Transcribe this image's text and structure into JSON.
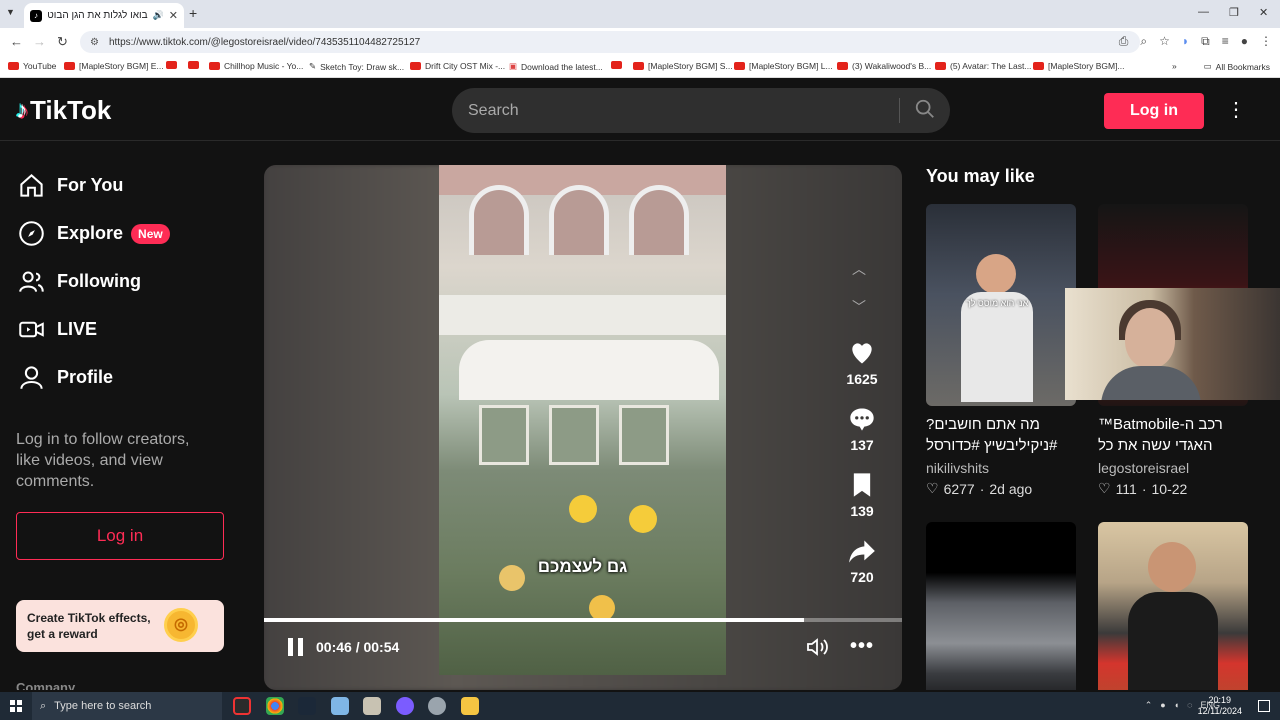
{
  "browser": {
    "tab_title": "בואו לגלות את הגן הבוטני :)",
    "new_tab": "+",
    "url": "https://www.tiktok.com/@legostoreisrael/video/7435351104482725127",
    "bookmarks": [
      "YouTube",
      "[MapleStory BGM] E...",
      "",
      "",
      "Chillhop Music - Yo...",
      "Sketch Toy: Draw sk...",
      "Drift City OST Mix -...",
      "Download the latest...",
      "",
      "[MapleStory BGM] S...",
      "[MapleStory BGM] L...",
      "(3) Wakaliwood's B...",
      "(5) Avatar: The Last...",
      "[MapleStory BGM]..."
    ],
    "all_bookmarks": "All Bookmarks"
  },
  "header": {
    "logo_text": "TikTok",
    "search_placeholder": "Search",
    "login_label": "Log in"
  },
  "sidebar": {
    "nav": [
      {
        "label": "For You",
        "icon": "home-icon"
      },
      {
        "label": "Explore",
        "icon": "compass-icon",
        "badge": "New"
      },
      {
        "label": "Following",
        "icon": "users-icon"
      },
      {
        "label": "LIVE",
        "icon": "live-icon"
      },
      {
        "label": "Profile",
        "icon": "user-icon"
      }
    ],
    "prompt": "Log in to follow creators, like videos, and view comments.",
    "login_label": "Log in",
    "effects": "Create TikTok effects, get a reward",
    "company": "Company"
  },
  "player": {
    "caption": "גם לעצמכם",
    "likes": "1625",
    "comments": "137",
    "saves": "139",
    "shares": "720",
    "time": "00:46 / 00:54",
    "progress": 0.846
  },
  "recommend": {
    "title": "You may like",
    "cards": [
      {
        "desc": "מה אתם חושבים? #ניקיליבשיץ #כדורסל",
        "author": "nikilivshits",
        "likes": "6277",
        "date": "2d ago",
        "overlay": "אני הוא מוסס לך"
      },
      {
        "desc": "רכב ה-Batmobile™ האגדי עשה את כל הדרך...",
        "author": "legostoreisrael",
        "likes": "111",
        "date": "10-22"
      },
      {
        "desc": "",
        "author": "",
        "likes": "",
        "date": ""
      },
      {
        "desc": "",
        "author": "",
        "likes": "",
        "date": ""
      }
    ]
  },
  "taskbar": {
    "search_placeholder": "Type here to search",
    "lang": "ENG",
    "time": "20:19",
    "date": "12/11/2024"
  },
  "colors": {
    "accent": "#fe2c55",
    "bg": "#121212"
  }
}
